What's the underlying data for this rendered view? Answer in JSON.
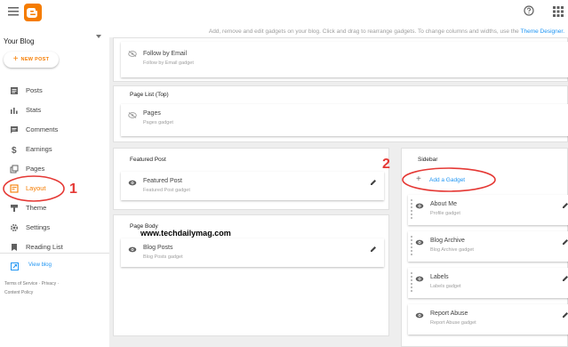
{
  "topbar": {
    "menu_icon": "hamburger-icon",
    "logo_icon": "blogger-logo",
    "help_icon": "help-icon",
    "apps_icon": "apps-grid-icon"
  },
  "sidebar": {
    "blog_name": "Your Blog",
    "new_post": {
      "plus": "+",
      "label": "NEW POST"
    },
    "items": [
      {
        "label": "Posts",
        "icon": "posts-icon"
      },
      {
        "label": "Stats",
        "icon": "stats-icon"
      },
      {
        "label": "Comments",
        "icon": "comments-icon"
      },
      {
        "label": "Earnings",
        "icon": "dollar-icon"
      },
      {
        "label": "Pages",
        "icon": "pages-icon"
      },
      {
        "label": "Layout",
        "icon": "layout-icon",
        "active": true
      },
      {
        "label": "Theme",
        "icon": "theme-icon"
      },
      {
        "label": "Settings",
        "icon": "gear-icon"
      },
      {
        "label": "Reading List",
        "icon": "bookmark-icon"
      }
    ],
    "view_blog": "View blog",
    "footer": {
      "terms": "Terms of Service",
      "sep": "·",
      "privacy": "Privacy",
      "sep2": "·",
      "content_policy": "Content Policy"
    }
  },
  "main": {
    "info_text": "Add, remove and edit gadgets on your blog. Click and drag to rearrange gadgets. To change columns and widths, use the",
    "theme_designer": "Theme Designer.",
    "follow_gadget": {
      "title": "Follow by Email",
      "sub": "Follow by Email gadget"
    },
    "page_list": {
      "title": "Page List (Top)",
      "gadget_title": "Pages",
      "gadget_sub": "Pages gadget"
    },
    "featured_post": {
      "title": "Featured Post",
      "gadget_title": "Featured Post",
      "gadget_sub": "Featured Post gadget"
    },
    "page_body": {
      "title": "Page Body",
      "gadget_title": "Blog Posts",
      "gadget_sub": "Blog Posts gadget"
    },
    "sidebar_panel": {
      "title": "Sidebar",
      "add_plus": "+",
      "add_label": "Add a Gadget",
      "gadgets": [
        {
          "title": "About Me",
          "sub": "Profile gadget"
        },
        {
          "title": "Blog Archive",
          "sub": "Blog Archive gadget"
        },
        {
          "title": "Labels",
          "sub": "Labels gadget"
        },
        {
          "title": "Report Abuse",
          "sub": "Report Abuse gadget"
        }
      ]
    }
  },
  "annotations": {
    "one": "1",
    "two": "2",
    "watermark": "www.techdailymag.com"
  },
  "colors": {
    "accent": "#f57c00",
    "link": "#2196f3",
    "annotation": "#e53935"
  }
}
